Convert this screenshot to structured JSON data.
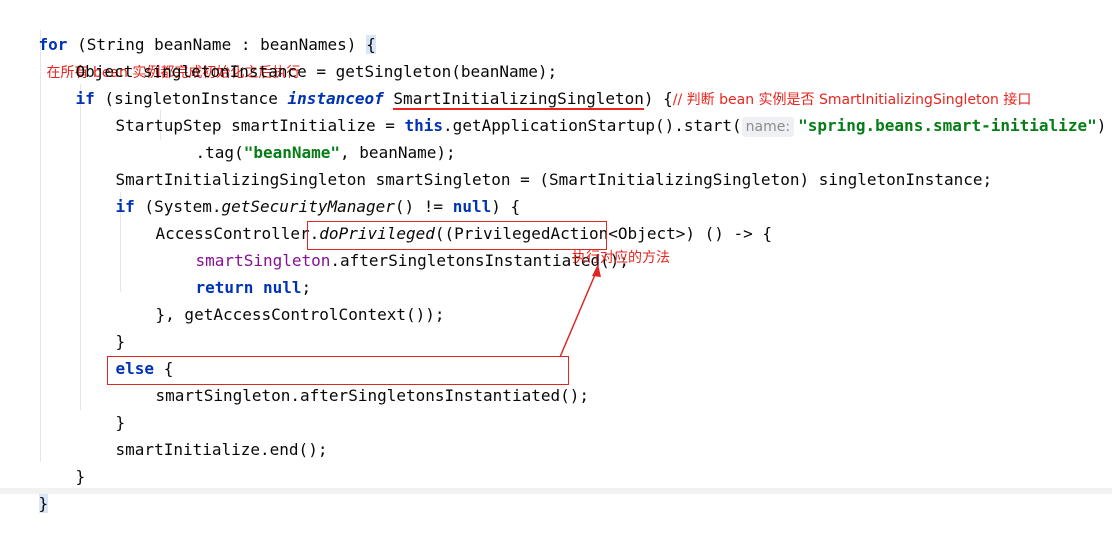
{
  "code": {
    "line1": {
      "kw_for": "for",
      "open": " (String beanName : beanNames) ",
      "brace": "{",
      "comment": "在所有 bean 实例都完成初始化之后执行"
    },
    "line2": {
      "text": "Object singletonInstance = getSingleton(beanName);"
    },
    "line3": {
      "kw_if": "if",
      "part1": " (singletonInstance ",
      "kw_instanceof": "instanceof",
      "space": " ",
      "type": "SmartInitializingSingleton",
      "part2": ") {",
      "comment": "// 判断 bean 实例是否 SmartInitializingSingleton 接口"
    },
    "line4": {
      "part1": "StartupStep smartInitialize = ",
      "kw_this": "this",
      "part2": ".getApplicationStartup().start(",
      "hint": "name:",
      "str": "\"spring.beans.smart-initialize\"",
      "part3": ")"
    },
    "line5": {
      "part1": ".tag(",
      "str": "\"beanName\"",
      "part2": ", beanName);"
    },
    "line6": {
      "text": "SmartInitializingSingleton smartSingleton = (SmartInitializingSingleton) singletonInstance;"
    },
    "line7": {
      "kw_if": "if",
      "part1": " (System.",
      "method": "getSecurityManager",
      "part2": "() != ",
      "kw_null": "null",
      "part3": ") {"
    },
    "line8": {
      "part1": "AccessController.",
      "method": "doPrivileged",
      "part2": "((PrivilegedAction<Object>) () -> {"
    },
    "line9": {
      "var": "smartSingleton",
      "part1": ".afterSingletonsInstantiated();"
    },
    "line10": {
      "kw_return": "return",
      "space": " ",
      "kw_null": "null",
      "part1": ";"
    },
    "line11": {
      "text": "}, getAccessControlContext());"
    },
    "line12": {
      "text": "}"
    },
    "line13": {
      "kw_else": "else",
      "part1": " {"
    },
    "line14": {
      "text": "smartSingleton.afterSingletonsInstantiated();"
    },
    "line15": {
      "text": "}"
    },
    "line16": {
      "text": "smartInitialize.end();"
    },
    "line17": {
      "text": "}"
    },
    "line18": {
      "text": "}"
    }
  },
  "annotations": {
    "call_label": "执行对应的方法"
  },
  "colors": {
    "keyword": "#0033b3",
    "string": "#067d17",
    "field": "#871094",
    "annotation_red": "#e8251f"
  }
}
